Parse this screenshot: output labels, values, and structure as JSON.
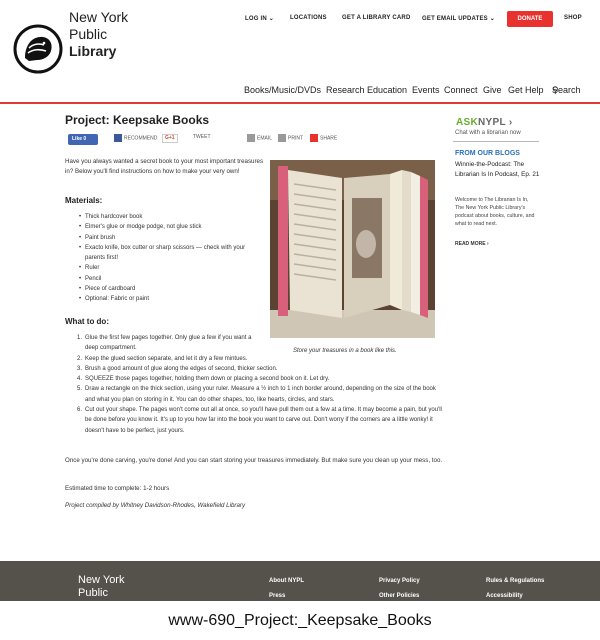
{
  "brand": {
    "line1": "New York",
    "line2": "Public",
    "line3": "Library"
  },
  "top_nav": {
    "login": "LOG IN",
    "locations": "LOCATIONS",
    "library_card": "GET A LIBRARY CARD",
    "email_updates": "GET EMAIL UPDATES",
    "donate": "DONATE",
    "shop": "SHOP"
  },
  "main_nav": [
    "Books/Music/DVDs",
    "Research",
    "Education",
    "Events",
    "Connect",
    "Give",
    "Get Help",
    "Search"
  ],
  "article": {
    "title": "Project: Keepsake Books",
    "share": {
      "like": "Like 0",
      "recommend": "RECOMMEND",
      "gplus": "G+1",
      "tweet": "TWEET",
      "email": "EMAIL",
      "print": "PRINT",
      "share": "SHARE"
    },
    "intro": "Have you always wanted a secret book to your most important treasures in?  Below you'll find instructions on how to make your very own!",
    "materials_heading": "Materials:",
    "materials": [
      "Thick hardcover book",
      "Elmer's glue or modge podge, not glue stick",
      "Paint brush",
      "Exacto knife, box cutter or sharp scissors — check with your parents first!",
      "Ruler",
      "Pencil",
      "Piece of cardboard",
      "Optional:  Fabric or paint"
    ],
    "steps_heading": "What to do:",
    "steps": [
      "Glue the first few pages together.  Only glue a few if you want a deep compartment.",
      "Keep the glued section separate, and let it dry a few mintues.",
      "Brush a good amount of glue along the edges of second, thicker section.",
      "SQUEEZE those pages together, holding them down or placing a second book on it. Let dry.",
      "Draw a rectangle on the thick section, using your ruler. Measure a ½ inch to 1 inch border around, depending on the size of the book and what you plan on storing in it. You can do other shapes, too, like hearts, circles, and stars.",
      "Cut out your shape. The pages won't come out all at once, so you'll have pull them out a few at a time.  It may become a pain, but you'll be done before you know it.  It's up to you how far into the book you want to carve out. Don't worry if the corners are a little wonky!  it doesn't have to be perfect, just yours."
    ],
    "closing": "Once you're done carving, you're done!  And you can start storing your treasures immediately.  But make sure you clean up your mess, too.",
    "time": "Estimated time to complete: 1-2 hours",
    "credit": "Project compiled by Whitney Davidson-Rhodes, Wakefield Library",
    "photo_caption": "Store your treasures in a book like this."
  },
  "sidebar": {
    "ask_a": "ASK",
    "ask_b": "NYPL",
    "ask_sub": "Chat with a librarian now",
    "blogs_heading": "FROM OUR BLOGS",
    "blog_title": "Winnie-the-Podcast: The Librarian Is In Podcast, Ep. 21",
    "blog_desc": "Welcome to The Librarian Is In, The New York Public Library's podcast about books, culture, and what to read next.",
    "read_more": "READ MORE ›"
  },
  "footer": {
    "logo1": "New York",
    "logo2": "Public",
    "links": [
      "About NYPL",
      "Privacy Policy",
      "Rules & Regulations",
      "Press",
      "Other Policies",
      "Accessibility"
    ]
  },
  "page_caption": "www-690_Project:_Keepsake_Books",
  "colors": {
    "accent_red": "#e03a37",
    "link_blue": "#2a6ebb",
    "ask_green": "#6aac2e",
    "footer_bg": "#55514b"
  },
  "icons": [
    "lion-logo-icon",
    "chevron-down-icon",
    "search-icon",
    "facebook-icon",
    "email-icon",
    "print-icon",
    "share-plus-icon"
  ]
}
